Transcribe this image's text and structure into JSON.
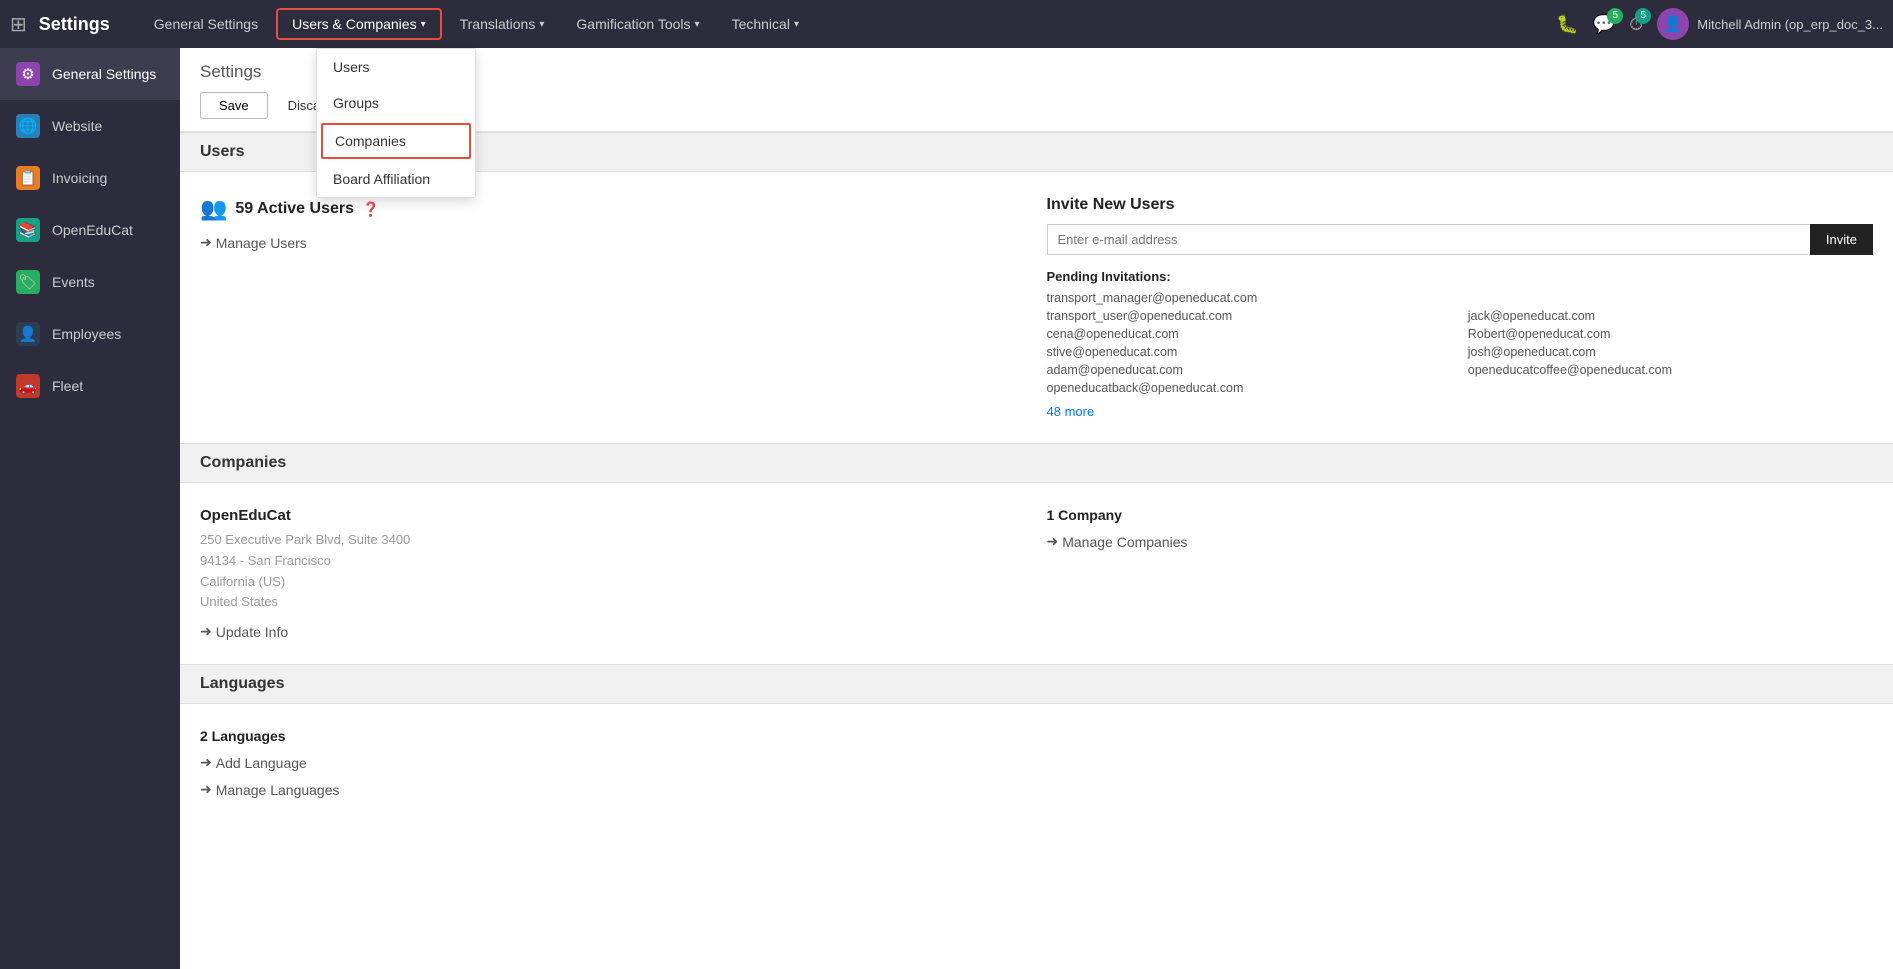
{
  "app": {
    "title": "Settings"
  },
  "topnav": {
    "title": "Settings",
    "menu_items": [
      {
        "id": "general-settings",
        "label": "General Settings",
        "active": false,
        "has_dropdown": false
      },
      {
        "id": "users-companies",
        "label": "Users & Companies",
        "active": true,
        "has_dropdown": true
      },
      {
        "id": "translations",
        "label": "Translations",
        "active": false,
        "has_dropdown": true
      },
      {
        "id": "gamification-tools",
        "label": "Gamification Tools",
        "active": false,
        "has_dropdown": true
      },
      {
        "id": "technical",
        "label": "Technical",
        "active": false,
        "has_dropdown": true
      }
    ],
    "right": {
      "bug_icon": "🐛",
      "chat_icon": "💬",
      "chat_badge": "5",
      "clock_icon": "⏱",
      "clock_badge": "5",
      "user_name": "Mitchell Admin (op_erp_doc_3..."
    }
  },
  "dropdown": {
    "items": [
      {
        "id": "users",
        "label": "Users",
        "highlighted": false
      },
      {
        "id": "groups",
        "label": "Groups",
        "highlighted": false
      },
      {
        "id": "companies",
        "label": "Companies",
        "highlighted": true
      },
      {
        "id": "board-affiliation",
        "label": "Board Affiliation",
        "highlighted": false
      }
    ]
  },
  "sidebar": {
    "items": [
      {
        "id": "general-settings",
        "label": "General Settings",
        "icon": "⚙",
        "color": "purple"
      },
      {
        "id": "website",
        "label": "Website",
        "icon": "🌐",
        "color": "blue"
      },
      {
        "id": "invoicing",
        "label": "Invoicing",
        "icon": "📋",
        "color": "orange"
      },
      {
        "id": "openeducat",
        "label": "OpenEduCat",
        "icon": "📚",
        "color": "teal"
      },
      {
        "id": "events",
        "label": "Events",
        "icon": "🏷",
        "color": "green"
      },
      {
        "id": "employees",
        "label": "Employees",
        "icon": "👤",
        "color": "darkblue"
      },
      {
        "id": "fleet",
        "label": "Fleet",
        "icon": "🚗",
        "color": "red"
      }
    ]
  },
  "settings_header": {
    "title": "Settings",
    "save_label": "Save",
    "discard_label": "Discard"
  },
  "sections": {
    "users": {
      "title": "Users",
      "active_count": "59 Active Users",
      "manage_link": "Manage Users",
      "invite_title": "Invite New Users",
      "invite_placeholder": "Enter e-mail address",
      "invite_button": "Invite",
      "pending_title": "Pending Invitations:",
      "pending_emails": [
        "transport_manager@openeducat.com",
        "",
        "transport_user@openeducat.com",
        "jack@openeducat.com",
        "cena@openeducat.com",
        "Robert@openeducat.com",
        "stive@openeducat.com",
        "josh@openeducat.com",
        "adam@openeducat.com",
        "openeducatcoffee@openeducat.com",
        "openeducatback@openeducat.com",
        ""
      ],
      "more_link": "48 more"
    },
    "companies": {
      "title": "Companies",
      "company_name": "OpenEduCat",
      "address_line1": "250 Executive Park Blvd, Suite 3400",
      "address_line2": "94134 - San Francisco",
      "address_line3": "California (US)",
      "address_line4": "United States",
      "update_link": "Update Info",
      "company_count": "1 Company",
      "manage_link": "Manage Companies"
    },
    "languages": {
      "title": "Languages",
      "lang_count": "2 Languages",
      "add_link": "Add Language",
      "manage_link": "Manage Languages"
    }
  }
}
